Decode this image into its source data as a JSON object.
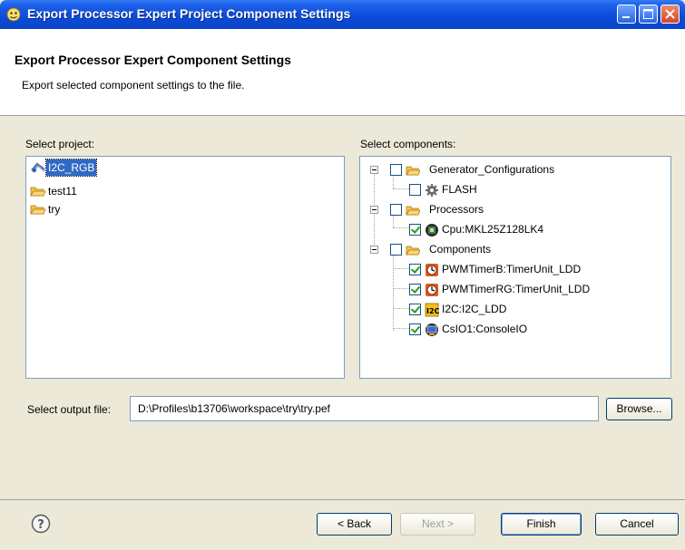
{
  "window": {
    "title": "Export Processor Expert Project Component Settings"
  },
  "header": {
    "title": "Export Processor Expert Component Settings",
    "description": "Export selected component settings to the file."
  },
  "projects": {
    "label": "Select project:",
    "items": [
      {
        "label": "I2C_RGB",
        "icon": "project-icon",
        "selected": true
      },
      {
        "label": "test11",
        "icon": "folder-icon",
        "selected": false
      },
      {
        "label": "try",
        "icon": "folder-icon",
        "selected": false
      }
    ]
  },
  "components": {
    "label": "Select components:",
    "tree": [
      {
        "label": "Generator_Configurations",
        "icon": "folder-icon",
        "checked": false,
        "level": 0,
        "expander": true
      },
      {
        "label": "FLASH",
        "icon": "gear-icon",
        "checked": false,
        "level": 1,
        "expander": false
      },
      {
        "label": "Processors",
        "icon": "folder-icon",
        "checked": false,
        "level": 0,
        "expander": true
      },
      {
        "label": "Cpu:MKL25Z128LK4",
        "icon": "cpu-icon",
        "checked": true,
        "level": 1,
        "expander": false
      },
      {
        "label": "Components",
        "icon": "folder-icon",
        "checked": false,
        "level": 0,
        "expander": true
      },
      {
        "label": "PWMTimerB:TimerUnit_LDD",
        "icon": "timer-icon",
        "checked": true,
        "level": 1,
        "expander": false
      },
      {
        "label": "PWMTimerRG:TimerUnit_LDD",
        "icon": "timer-icon",
        "checked": true,
        "level": 1,
        "expander": false
      },
      {
        "label": "I2C:I2C_LDD",
        "icon": "i2c-icon",
        "checked": true,
        "level": 1,
        "expander": false
      },
      {
        "label": "CsIO1:ConsoleIO",
        "icon": "console-icon",
        "checked": true,
        "level": 1,
        "expander": false
      }
    ]
  },
  "output": {
    "label": "Select output file:",
    "value": "D:\\Profiles\\b13706\\workspace\\try\\try.pef",
    "browse_label": "Browse..."
  },
  "footer": {
    "back_label": "< Back",
    "next_label": "Next >",
    "finish_label": "Finish",
    "cancel_label": "Cancel"
  }
}
